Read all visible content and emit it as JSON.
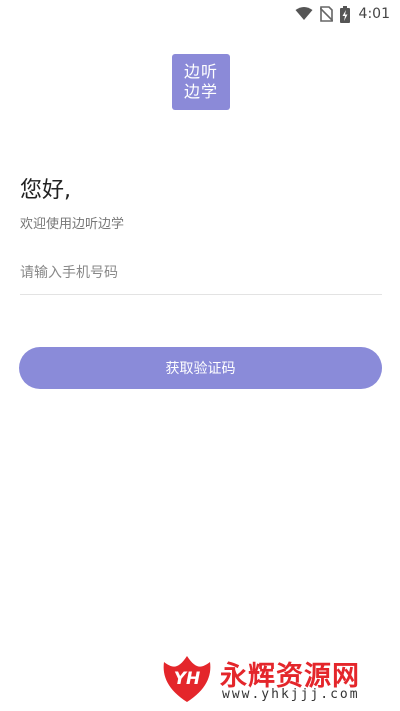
{
  "status_bar": {
    "time": "4:01",
    "icons": [
      "wifi-icon",
      "no-sim-icon",
      "battery-charging-icon"
    ]
  },
  "logo": {
    "line1": "边听",
    "line2": "边学",
    "color": "#8b8ad8"
  },
  "greeting": {
    "title": "您好,",
    "subtitle": "欢迎使用边听边学"
  },
  "phone_input": {
    "placeholder": "请输入手机号码",
    "value": ""
  },
  "button": {
    "label": "获取验证码",
    "color": "#8a8bd9"
  },
  "watermark": {
    "logo_text": "YH",
    "title": "永辉资源网",
    "url": "www.yhkjjj.com"
  }
}
